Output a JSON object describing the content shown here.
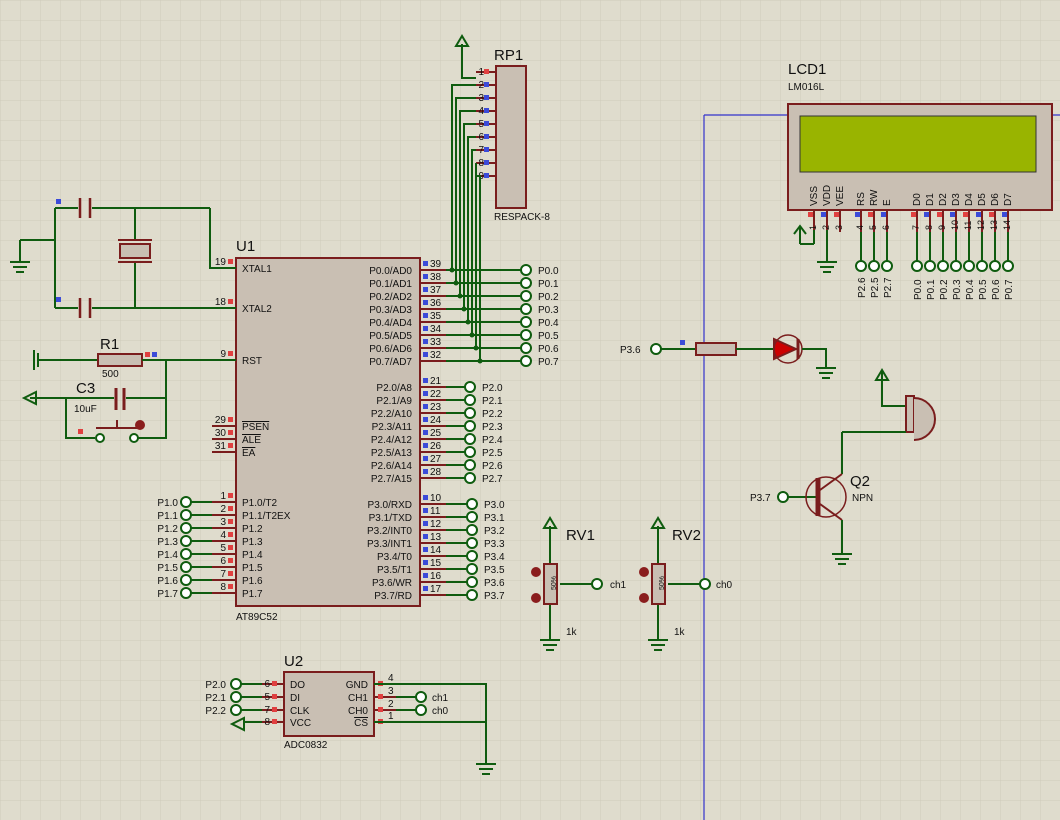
{
  "u1": {
    "ref": "U1",
    "part": "AT89C52",
    "left_pins": [
      {
        "num": "19",
        "name": "XTAL1"
      },
      {
        "num": "18",
        "name": "XTAL2"
      },
      {
        "num": "9",
        "name": "RST"
      },
      {
        "num": "29",
        "name": "PSEN"
      },
      {
        "num": "30",
        "name": "ALE"
      },
      {
        "num": "31",
        "name": "EA"
      },
      {
        "num": "1",
        "name": "P1.0/T2"
      },
      {
        "num": "2",
        "name": "P1.1/T2EX"
      },
      {
        "num": "3",
        "name": "P1.2"
      },
      {
        "num": "4",
        "name": "P1.3"
      },
      {
        "num": "5",
        "name": "P1.4"
      },
      {
        "num": "6",
        "name": "P1.5"
      },
      {
        "num": "7",
        "name": "P1.6"
      },
      {
        "num": "8",
        "name": "P1.7"
      }
    ],
    "p1_nets": [
      "P1.0",
      "P1.1",
      "P1.2",
      "P1.3",
      "P1.4",
      "P1.5",
      "P1.6",
      "P1.7"
    ],
    "p0_pins": [
      {
        "num": "39",
        "name": "P0.0/AD0",
        "net": "P0.0"
      },
      {
        "num": "38",
        "name": "P0.1/AD1",
        "net": "P0.1"
      },
      {
        "num": "37",
        "name": "P0.2/AD2",
        "net": "P0.2"
      },
      {
        "num": "36",
        "name": "P0.3/AD3",
        "net": "P0.3"
      },
      {
        "num": "35",
        "name": "P0.4/AD4",
        "net": "P0.4"
      },
      {
        "num": "34",
        "name": "P0.5/AD5",
        "net": "P0.5"
      },
      {
        "num": "33",
        "name": "P0.6/AD6",
        "net": "P0.6"
      },
      {
        "num": "32",
        "name": "P0.7/AD7",
        "net": "P0.7"
      }
    ],
    "p2_pins": [
      {
        "num": "21",
        "name": "P2.0/A8",
        "net": "P2.0"
      },
      {
        "num": "22",
        "name": "P2.1/A9",
        "net": "P2.1"
      },
      {
        "num": "23",
        "name": "P2.2/A10",
        "net": "P2.2"
      },
      {
        "num": "24",
        "name": "P2.3/A11",
        "net": "P2.3"
      },
      {
        "num": "25",
        "name": "P2.4/A12",
        "net": "P2.4"
      },
      {
        "num": "26",
        "name": "P2.5/A13",
        "net": "P2.5"
      },
      {
        "num": "27",
        "name": "P2.6/A14",
        "net": "P2.6"
      },
      {
        "num": "28",
        "name": "P2.7/A15",
        "net": "P2.7"
      }
    ],
    "p3_pins": [
      {
        "num": "10",
        "name": "P3.0/RXD",
        "net": "P3.0"
      },
      {
        "num": "11",
        "name": "P3.1/TXD",
        "net": "P3.1"
      },
      {
        "num": "12",
        "name": "P3.2/INT0",
        "net": "P3.2"
      },
      {
        "num": "13",
        "name": "P3.3/INT1",
        "net": "P3.3"
      },
      {
        "num": "14",
        "name": "P3.4/T0",
        "net": "P3.4"
      },
      {
        "num": "15",
        "name": "P3.5/T1",
        "net": "P3.5"
      },
      {
        "num": "16",
        "name": "P3.6/WR",
        "net": "P3.6"
      },
      {
        "num": "17",
        "name": "P3.7/RD",
        "net": "P3.7"
      }
    ]
  },
  "rp1": {
    "ref": "RP1",
    "part": "RESPACK-8",
    "pins": [
      "1",
      "2",
      "3",
      "4",
      "5",
      "6",
      "7",
      "8",
      "9"
    ]
  },
  "lcd1": {
    "ref": "LCD1",
    "part": "LM016L",
    "pin_names": [
      "VSS",
      "VDD",
      "VEE",
      "RS",
      "RW",
      "E",
      "D0",
      "D1",
      "D2",
      "D3",
      "D4",
      "D5",
      "D6",
      "D7"
    ],
    "pin_nums": [
      "1",
      "2",
      "3",
      "4",
      "5",
      "6",
      "7",
      "8",
      "9",
      "10",
      "11",
      "12",
      "13",
      "14"
    ],
    "ctrl_nets": [
      "P2.6",
      "P2.5",
      "P2.7"
    ],
    "data_nets": [
      "P0.0",
      "P0.1",
      "P0.2",
      "P0.3",
      "P0.4",
      "P0.5",
      "P0.6",
      "P0.7"
    ],
    "screen_color": "#99b400"
  },
  "r1": {
    "ref": "R1",
    "value": "500"
  },
  "c3": {
    "ref": "C3",
    "value": "10uF"
  },
  "led_net": "P3.6",
  "q2": {
    "ref": "Q2",
    "type": "NPN",
    "net": "P3.7"
  },
  "rv1": {
    "ref": "RV1",
    "value": "1k",
    "pct": "50%",
    "net": "ch1"
  },
  "rv2": {
    "ref": "RV2",
    "value": "1k",
    "pct": "50%",
    "net": "ch0"
  },
  "u2": {
    "ref": "U2",
    "part": "ADC0832",
    "left_pins": [
      {
        "num": "6",
        "name": "DO",
        "net": "P2.0"
      },
      {
        "num": "5",
        "name": "DI",
        "net": "P2.1"
      },
      {
        "num": "7",
        "name": "CLK",
        "net": "P2.2"
      },
      {
        "num": "8",
        "name": "VCC",
        "net": ""
      }
    ],
    "right_pins": [
      {
        "num": "4",
        "name": "GND",
        "net": ""
      },
      {
        "num": "3",
        "name": "CH1",
        "net": "ch1"
      },
      {
        "num": "2",
        "name": "CH0",
        "net": "ch0"
      },
      {
        "num": "1",
        "name": "CS",
        "net": ""
      }
    ]
  }
}
